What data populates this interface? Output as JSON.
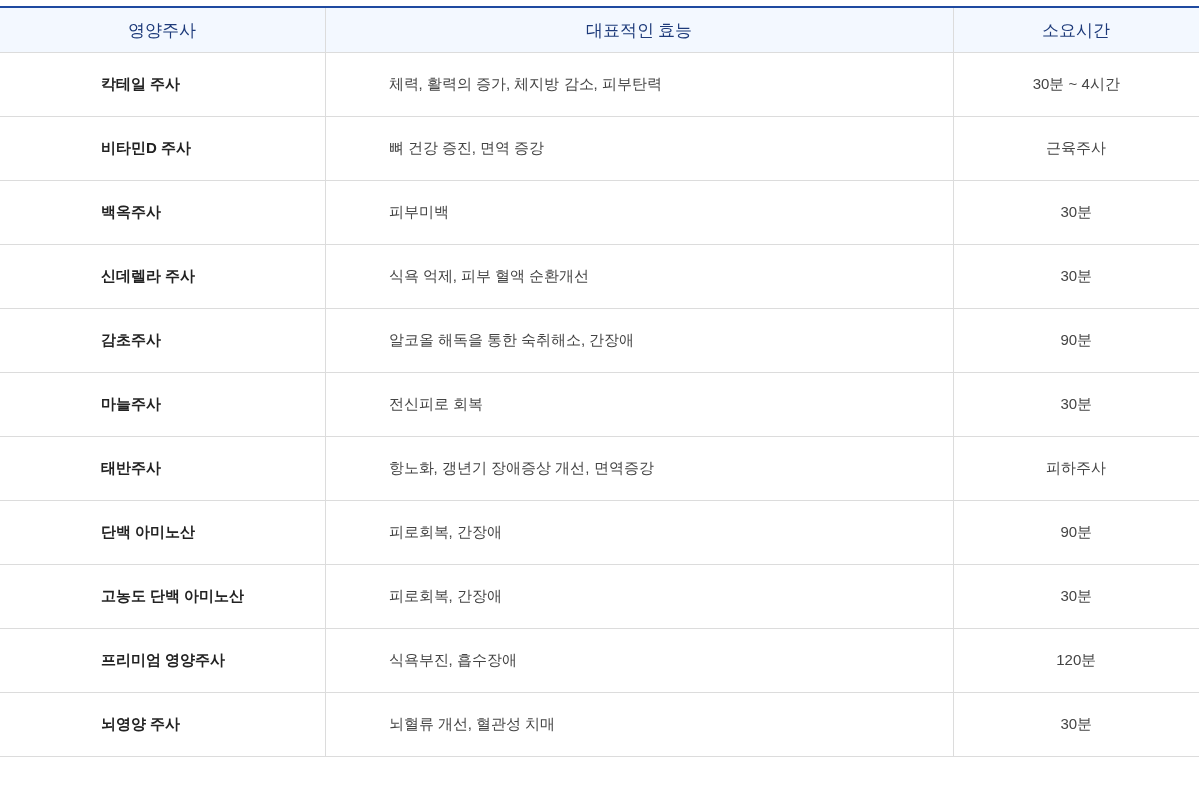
{
  "table": {
    "columns": [
      "영양주사",
      "대표적인 효능",
      "소요시간"
    ],
    "rows": [
      {
        "name": "칵테일 주사",
        "effect": "체력, 활력의 증가, 체지방 감소, 피부탄력",
        "time": "30분 ~ 4시간"
      },
      {
        "name": "비타민D 주사",
        "effect": "뼈 건강 증진, 면역 증강",
        "time": "근육주사"
      },
      {
        "name": "백옥주사",
        "effect": "피부미백",
        "time": "30분"
      },
      {
        "name": "신데렐라 주사",
        "effect": "식욕 억제, 피부 혈액 순환개선",
        "time": "30분"
      },
      {
        "name": "감초주사",
        "effect": "알코올 해독을 통한 숙취해소, 간장애",
        "time": "90분"
      },
      {
        "name": "마늘주사",
        "effect": "전신피로 회복",
        "time": "30분"
      },
      {
        "name": "태반주사",
        "effect": "항노화, 갱년기 장애증상 개선, 면역증강",
        "time": "피하주사"
      },
      {
        "name": "단백 아미노산",
        "effect": "피로회복, 간장애",
        "time": "90분"
      },
      {
        "name": "고농도 단백 아미노산",
        "effect": "피로회복, 간장애",
        "time": "30분"
      },
      {
        "name": "프리미엄 영양주사",
        "effect": "식욕부진, 흡수장애",
        "time": "120분"
      },
      {
        "name": "뇌영양 주사",
        "effect": "뇌혈류 개선, 혈관성 치매",
        "time": "30분"
      }
    ]
  }
}
